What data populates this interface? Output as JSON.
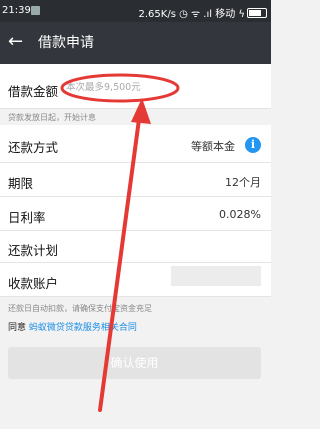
{
  "status_bar": {
    "time": "21:39",
    "right": "2.65K/s ◷ ᯤ .ıl 移动 ϟ"
  },
  "header": {
    "back_icon": "←",
    "title": "借款申请"
  },
  "form": {
    "amount_label": "借款金额",
    "amount_placeholder": "本次最多9,500元",
    "amount_hint": "贷款发放日起，开始计息",
    "repay_method_label": "还款方式",
    "repay_method_value": "等额本金",
    "info_icon": "i",
    "term_label": "期限",
    "term_value": "12个月",
    "daily_rate_label": "日利率",
    "daily_rate_value": "0.028%",
    "plan_label": "还款计划",
    "account_label": "收款账户",
    "auto_debit_hint": "还款日自动扣款，请确保支付宝资金充足",
    "agree_prefix": "同意",
    "agree_link": "蚂蚁微贷贷款服务相关合同",
    "confirm_button": "确认使用"
  },
  "colors": {
    "annotation": "#e53935",
    "link": "#1a8ee6"
  }
}
